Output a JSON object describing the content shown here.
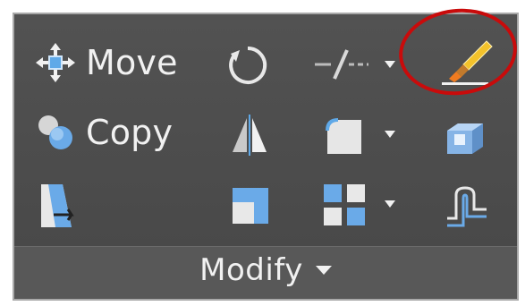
{
  "panel": {
    "title": "Modify",
    "accent_ring_color": "#c90b0b"
  },
  "tools": {
    "move_label": "Move",
    "copy_label": "Copy"
  },
  "icons": {
    "move": "move-icon",
    "rotate": "rotate-icon",
    "trim": "trim-icon",
    "match_properties": "match-properties-brush-icon",
    "copy": "copy-icon",
    "mirror": "mirror-icon",
    "fillet": "fillet-icon",
    "extend_3d": "solid-editing-icon",
    "stretch": "stretch-icon",
    "scale": "scale-icon",
    "array": "array-icon",
    "offset": "offset-icon"
  }
}
